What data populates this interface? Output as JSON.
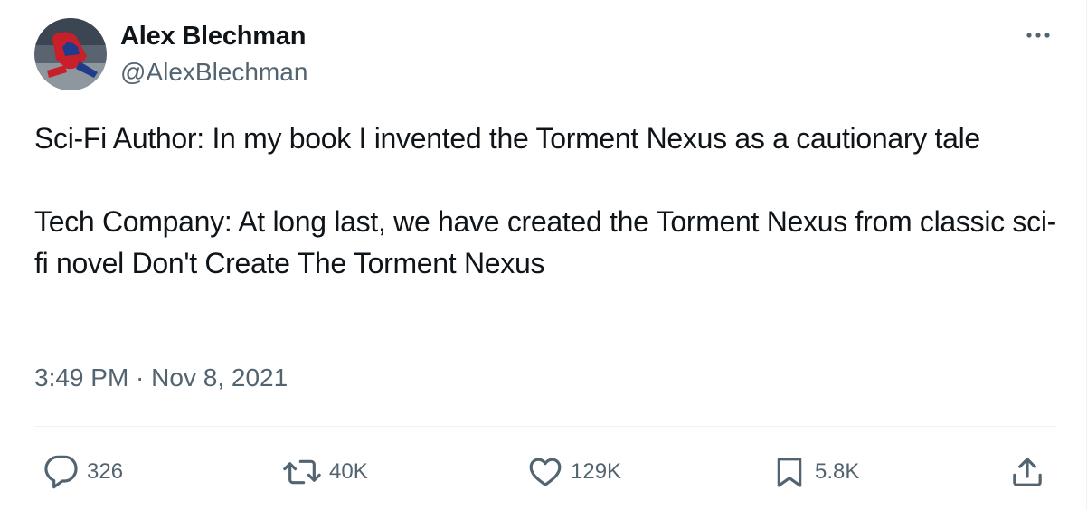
{
  "author": {
    "name": "Alex Blechman",
    "handle": "@AlexBlechman"
  },
  "tweet": {
    "paragraph_1": "Sci-Fi Author: In my book I invented the Torment Nexus as a cautionary tale",
    "paragraph_2": "Tech Company: At long last, we have created the Torment Nexus from classic sci-fi novel Don't Create The Torment Nexus",
    "time": "3:49 PM",
    "separator": " · ",
    "date": "Nov 8, 2021"
  },
  "actions": {
    "replies": "326",
    "retweets": "40K",
    "likes": "129K",
    "bookmarks": "5.8K"
  },
  "icons": {
    "more": "more-icon",
    "reply": "reply-icon",
    "retweet": "retweet-icon",
    "like": "heart-icon",
    "bookmark": "bookmark-icon",
    "share": "share-icon"
  },
  "colors": {
    "text_primary": "#0f1419",
    "text_secondary": "#536471",
    "divider": "#eff3f4"
  }
}
